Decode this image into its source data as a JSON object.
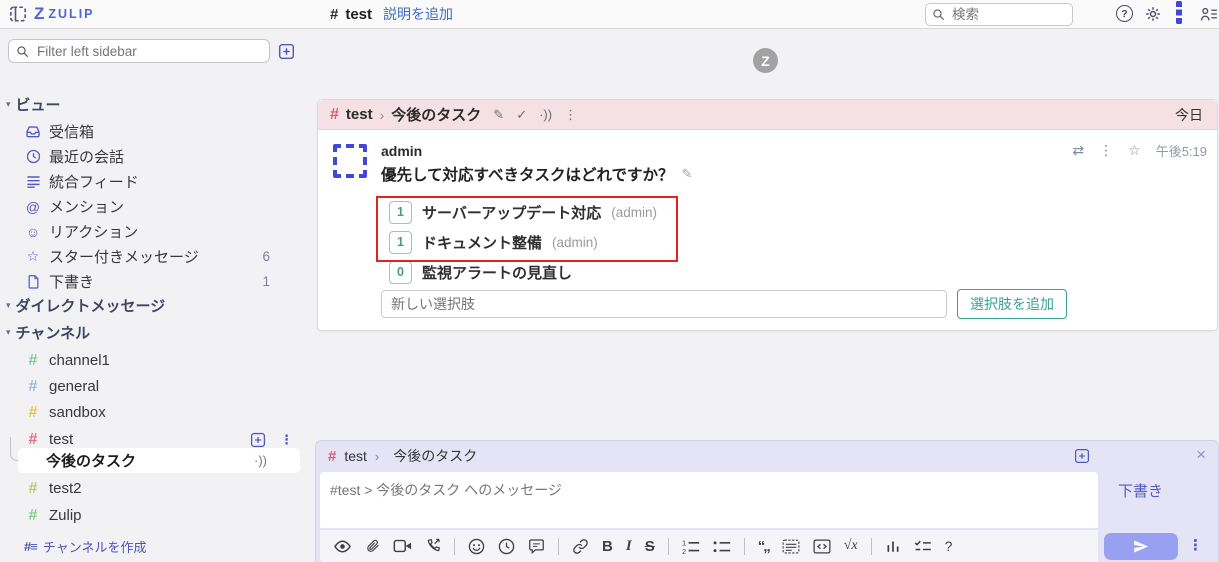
{
  "topbar": {
    "logo_z": "Z",
    "logo_word": "ZULIP",
    "stream_name": "test",
    "add_description_link": "説明を追加",
    "search_placeholder": "検索"
  },
  "sidebar": {
    "filter_placeholder": "Filter left sidebar",
    "views_header": "ビュー",
    "views": [
      {
        "label": "受信箱"
      },
      {
        "label": "最近の会話"
      },
      {
        "label": "統合フィード"
      },
      {
        "label": "メンション"
      },
      {
        "label": "リアクション"
      },
      {
        "label": "スター付きメッセージ",
        "count": "6"
      },
      {
        "label": "下書き",
        "count": "1"
      }
    ],
    "dm_header": "ダイレクトメッセージ",
    "channels_header": "チャンネル",
    "channels": [
      {
        "name": "channel1",
        "color": "#76ce9b"
      },
      {
        "name": "general",
        "color": "#9bb9e2"
      },
      {
        "name": "sandbox",
        "color": "#e7c84f"
      },
      {
        "name": "test",
        "color": "#e86a7c"
      },
      {
        "name": "test2",
        "color": "#b0cf66"
      },
      {
        "name": "Zulip",
        "color": "#7bd47e"
      }
    ],
    "active_topic": "今後のタスク",
    "create_channel_label": "チャンネルを作成"
  },
  "feed": {
    "loading_logo": "Z",
    "recipient": {
      "channel": "test",
      "topic": "今後のタスク",
      "date": "今日"
    },
    "message": {
      "sender": "admin",
      "timestamp": "午後5:19",
      "poll": {
        "question": "優先して対応すべきタスクはどれですか？",
        "options": [
          {
            "votes": "1",
            "label": "サーバーアップデート対応",
            "voters": "(admin)"
          },
          {
            "votes": "1",
            "label": "ドキュメント整備",
            "voters": "(admin)"
          },
          {
            "votes": "0",
            "label": "監視アラートの見直し",
            "voters": ""
          }
        ],
        "new_option_placeholder": "新しい選択肢",
        "add_option_button": "選択肢を追加"
      }
    }
  },
  "compose": {
    "channel": "test",
    "topic": "今後のタスク",
    "message_placeholder": "#test > 今後のタスク へのメッセージ",
    "drafts_label": "下書き",
    "toolbar_text": {
      "bold": "B",
      "italic": "I",
      "strike": "S",
      "math": "√x",
      "quote": "“„",
      "help": "?"
    }
  },
  "glyphs": {
    "hash": "#",
    "caret_down": "▾",
    "kebab": "⋮",
    "star_outline": "☆",
    "check": "✓",
    "pencil": "✎",
    "at_sign": "@",
    "smiley": "☺",
    "feed_lines": "≡",
    "follow": "·))",
    "quote_reply": "⇄",
    "close": "×",
    "breadcrumb_chevron": "›",
    "help": "?"
  },
  "colors": {
    "brand_blue": "#4f63d8",
    "link_blue": "#3b6cc4",
    "sidebar_icon_indigo": "#5558c2",
    "recipient_bar_pink": "#f5e0e6",
    "annotation_red": "#e0241c",
    "poll_teal": "#3aa394",
    "send_lavender": "#98a1f1",
    "compose_bg": "#e4e4f6"
  }
}
